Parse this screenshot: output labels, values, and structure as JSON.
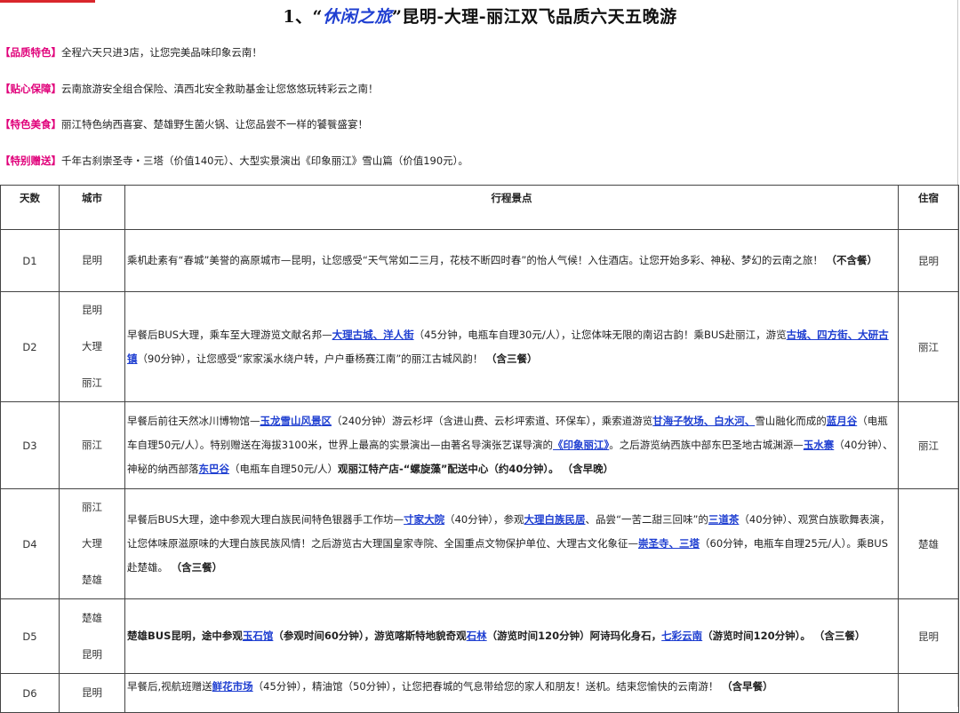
{
  "title": {
    "prefix": "1、“",
    "highlight": "休闲之旅",
    "suffix": "”昆明-大理-丽江双飞品质六天五晚游"
  },
  "features": [
    {
      "tag": "【品质特色】",
      "text": "全程六天只进3店，让您完美品味印象云南！"
    },
    {
      "tag": "【贴心保障】",
      "text": "云南旅游安全组合保险、滇西北安全救助基金让您悠悠玩转彩云之南！"
    },
    {
      "tag": "【特色美食】",
      "text": "丽江特色纳西喜宴、楚雄野生菌火锅、让您品尝不一样的饕餮盛宴！"
    },
    {
      "tag": "【特别赠送】",
      "text": "千年古刹崇圣寺・三塔（价值140元）、大型实景演出《印象丽江》雪山篇（价值190元）。"
    }
  ],
  "table": {
    "headers": {
      "day": "天数",
      "city": "城市",
      "route": "行程景点",
      "stay": "住宿"
    },
    "rows": [
      {
        "day": "D1",
        "cities": [
          "昆明"
        ],
        "stay": "昆明",
        "segments": [
          {
            "t": "乘机赴素有“春城”美誉的高原城市—昆明，让您感受“天气常如二三月，花枝不断四时春”的怡人气候！入住酒店。让您开始多彩、神秘、梦幻的云南之旅！ ",
            "s": "n"
          },
          {
            "t": "（不含餐）",
            "s": "b"
          }
        ]
      },
      {
        "day": "D2",
        "cities": [
          "昆明",
          "大理",
          "丽江"
        ],
        "stay": "丽江",
        "segments": [
          {
            "t": "早餐后BUS大理，乘车至大理游览文献名邦—",
            "s": "n"
          },
          {
            "t": "大理古城、洋人街",
            "s": "l"
          },
          {
            "t": "（45分钟，电瓶车自理30元/人），让您体味无限的南诏古韵！乘BUS赴丽江，游览",
            "s": "n"
          },
          {
            "t": "古城、四方街、大研古镇",
            "s": "l"
          },
          {
            "t": "（90分钟），让您感受“家家溪水绕户转，户户垂杨赛江南”的丽江古城风韵！ ",
            "s": "n"
          },
          {
            "t": "（含三餐）",
            "s": "b"
          }
        ]
      },
      {
        "day": "D3",
        "cities": [
          "丽江"
        ],
        "stay": "丽江",
        "segments": [
          {
            "t": "早餐后前往天然冰川博物馆—",
            "s": "n"
          },
          {
            "t": "玉龙雪山风景区",
            "s": "l"
          },
          {
            "t": "（240分钟）游云杉坪（含进山费、云杉坪索道、环保车），乘索道游览",
            "s": "n"
          },
          {
            "t": "甘海子牧场、白水河、",
            "s": "l"
          },
          {
            "t": "雪山融化而成的",
            "s": "n"
          },
          {
            "t": "蓝月谷",
            "s": "l"
          },
          {
            "t": "（电瓶车自理50元/人）。特别赠送在海拔3100米，世界上最高的实景演出—由著名导演张艺谋导演的",
            "s": "n"
          },
          {
            "t": "《印象丽江》",
            "s": "l"
          },
          {
            "t": "。之后游览纳西族中部东巴圣地古城渊源—",
            "s": "n"
          },
          {
            "t": "玉水寨",
            "s": "l"
          },
          {
            "t": "（40分钟）、神秘的纳西部落",
            "s": "n"
          },
          {
            "t": "东巴谷",
            "s": "l"
          },
          {
            "t": "（电瓶车自理50元/人）",
            "s": "n"
          },
          {
            "t": "观丽江特产店-“螺旋藻”配送中心（约40分钟）。 （含早晚）",
            "s": "b"
          }
        ]
      },
      {
        "day": "D4",
        "cities": [
          "丽江",
          "大理",
          "楚雄"
        ],
        "stay": "楚雄",
        "segments": [
          {
            "t": "早餐后BUS大理，途中参观大理白族民间特色银器手工作坊—",
            "s": "n"
          },
          {
            "t": "寸家大院",
            "s": "l"
          },
          {
            "t": "（40分钟），参观",
            "s": "n"
          },
          {
            "t": "大理白族民居",
            "s": "l"
          },
          {
            "t": "、品尝“一苦二甜三回味”的",
            "s": "n"
          },
          {
            "t": "三道茶",
            "s": "l"
          },
          {
            "t": "（40分钟）、观赏白族歌舞表演，让您体味原滋原味的大理白族民族风情！之后游览古大理国皇家寺院、全国重点文物保护单位、大理古文化象征—",
            "s": "n"
          },
          {
            "t": "崇圣寺、三塔",
            "s": "l"
          },
          {
            "t": "（60分钟，电瓶车自理25元/人）。乘BUS赴楚雄。 ",
            "s": "n"
          },
          {
            "t": "（含三餐）",
            "s": "b"
          }
        ]
      },
      {
        "day": "D5",
        "cities": [
          "楚雄",
          "昆明"
        ],
        "stay": "昆明",
        "segments": [
          {
            "t": "楚雄BUS昆明，途中参观",
            "s": "b"
          },
          {
            "t": "玉石馆",
            "s": "l"
          },
          {
            "t": "（参观时间60分钟），游览喀斯特地貌奇观",
            "s": "b"
          },
          {
            "t": "石林",
            "s": "l"
          },
          {
            "t": "（游览时间120分钟）阿诗玛化身石，",
            "s": "b"
          },
          {
            "t": "七彩云南",
            "s": "l"
          },
          {
            "t": "（游览时间120分钟）。 （含三餐）",
            "s": "b"
          }
        ]
      },
      {
        "day": "D6",
        "cities": [
          "昆明"
        ],
        "stay": "",
        "segments": [
          {
            "t": "早餐后,视航班赠送",
            "s": "n"
          },
          {
            "t": "鲜花市场",
            "s": "l"
          },
          {
            "t": "（45分钟），精油馆（50分钟），让您把春城的气息带给您的家人和朋友！送机。结束您愉快的云南游！ ",
            "s": "n"
          },
          {
            "t": "（含早餐）",
            "s": "b"
          }
        ]
      }
    ]
  },
  "colors": {
    "tag": "#e0007a",
    "link": "#1f3fd1",
    "topbar": "#d9262c"
  }
}
